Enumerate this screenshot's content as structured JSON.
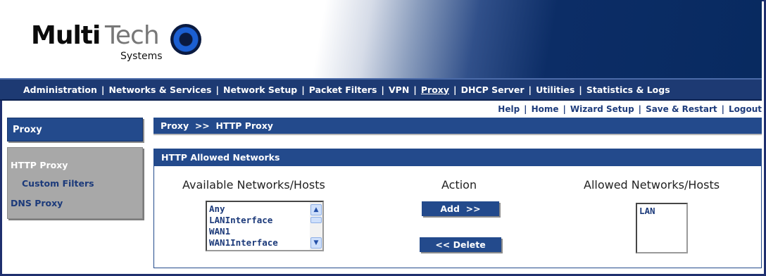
{
  "brand": {
    "logo_multi": "Multi",
    "logo_tech": "Tech",
    "logo_systems": "Systems"
  },
  "main_nav": {
    "items": [
      {
        "label": "Administration"
      },
      {
        "label": "Networks & Services"
      },
      {
        "label": "Network Setup"
      },
      {
        "label": "Packet Filters"
      },
      {
        "label": "VPN"
      },
      {
        "label": "Proxy"
      },
      {
        "label": "DHCP Server"
      },
      {
        "label": "Utilities"
      },
      {
        "label": "Statistics & Logs"
      }
    ],
    "active": "Proxy",
    "separator": "|"
  },
  "util_nav": {
    "items": [
      {
        "label": "Help"
      },
      {
        "label": "Home"
      },
      {
        "label": "Wizard Setup"
      },
      {
        "label": "Save & Restart"
      },
      {
        "label": "Logout"
      }
    ]
  },
  "sidebar": {
    "title": "Proxy",
    "items": [
      {
        "label": "HTTP Proxy",
        "selected": true
      },
      {
        "label": "Custom Filters"
      },
      {
        "label": "DNS Proxy"
      }
    ]
  },
  "breadcrumb": "Proxy  >>  HTTP Proxy",
  "panel": {
    "title": "HTTP Allowed Networks",
    "available_label": "Available Networks/Hosts",
    "action_label": "Action",
    "allowed_label": "Allowed Networks/Hosts",
    "available_options": [
      "Any",
      "LANInterface",
      "WAN1",
      "WAN1Interface"
    ],
    "allowed_options": [
      "LAN"
    ],
    "add_button": "Add  >>",
    "delete_button": "<< Delete"
  },
  "colors": {
    "nav_bg": "#1d3a73",
    "bar_bg": "#234a8c",
    "link": "#1e3c7c",
    "sidebar_body": "#a8a8a8"
  }
}
